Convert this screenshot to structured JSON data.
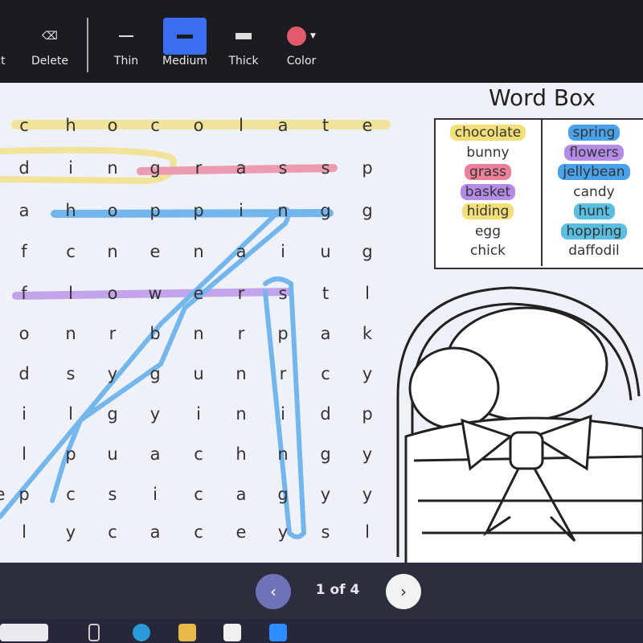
{
  "toolbar": {
    "tools": [
      {
        "label": "ct",
        "icon": "select-icon"
      },
      {
        "label": "Delete",
        "icon": "eraser-icon"
      },
      {
        "label": "Thin",
        "icon": "thin-line-icon"
      },
      {
        "label": "Medium",
        "icon": "medium-line-icon",
        "active": true
      },
      {
        "label": "Thick",
        "icon": "thick-line-icon"
      },
      {
        "label": "Color",
        "icon": "color-dot-icon",
        "color": "#e05a6a"
      }
    ]
  },
  "grid": {
    "edge_letter": "e",
    "rows": [
      "chocolate",
      "dinggrassp",
      "ahoppingg",
      "fcnenaiug",
      "flowerstl",
      "onrbnrpak",
      "dsygunrcy",
      "ilgyinidp",
      "lpuachngy",
      "pcsicagyy",
      "lycaceysl"
    ]
  },
  "word_box": {
    "title": "Word Box",
    "left": [
      {
        "word": "chocolate",
        "hl": "#f2df7a"
      },
      {
        "word": "bunny"
      },
      {
        "word": "grass",
        "hl": "#ec7f9a"
      },
      {
        "word": "basket",
        "hl": "#b58be8"
      },
      {
        "word": "hiding",
        "hl": "#f2df7a"
      },
      {
        "word": "egg"
      },
      {
        "word": "chick"
      }
    ],
    "right": [
      {
        "word": "spring",
        "hl": "#4aa3ea"
      },
      {
        "word": "flowers",
        "hl": "#b58be8"
      },
      {
        "word": "jellybean",
        "hl": "#4aa3ea"
      },
      {
        "word": "candy"
      },
      {
        "word": "hunt",
        "hl": "#5bbde0"
      },
      {
        "word": "hopping",
        "hl": "#5bbde0"
      },
      {
        "word": "daffodil"
      }
    ]
  },
  "pager": {
    "label": "1 of 4",
    "prev": "‹",
    "next": "›"
  }
}
